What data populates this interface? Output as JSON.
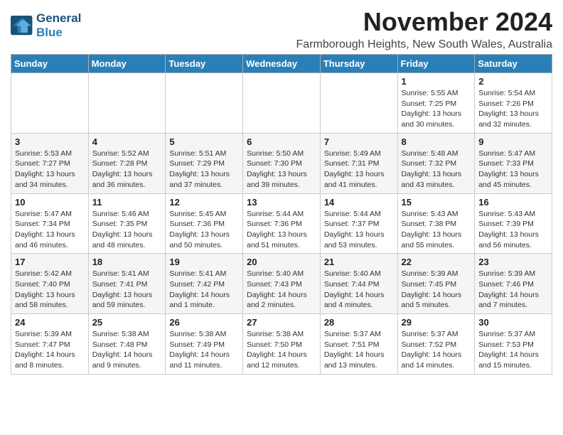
{
  "header": {
    "logo_line1": "General",
    "logo_line2": "Blue",
    "month_title": "November 2024",
    "location": "Farmborough Heights, New South Wales, Australia"
  },
  "days_of_week": [
    "Sunday",
    "Monday",
    "Tuesday",
    "Wednesday",
    "Thursday",
    "Friday",
    "Saturday"
  ],
  "weeks": [
    [
      {
        "day": "",
        "info": ""
      },
      {
        "day": "",
        "info": ""
      },
      {
        "day": "",
        "info": ""
      },
      {
        "day": "",
        "info": ""
      },
      {
        "day": "",
        "info": ""
      },
      {
        "day": "1",
        "info": "Sunrise: 5:55 AM\nSunset: 7:25 PM\nDaylight: 13 hours and 30 minutes."
      },
      {
        "day": "2",
        "info": "Sunrise: 5:54 AM\nSunset: 7:26 PM\nDaylight: 13 hours and 32 minutes."
      }
    ],
    [
      {
        "day": "3",
        "info": "Sunrise: 5:53 AM\nSunset: 7:27 PM\nDaylight: 13 hours and 34 minutes."
      },
      {
        "day": "4",
        "info": "Sunrise: 5:52 AM\nSunset: 7:28 PM\nDaylight: 13 hours and 36 minutes."
      },
      {
        "day": "5",
        "info": "Sunrise: 5:51 AM\nSunset: 7:29 PM\nDaylight: 13 hours and 37 minutes."
      },
      {
        "day": "6",
        "info": "Sunrise: 5:50 AM\nSunset: 7:30 PM\nDaylight: 13 hours and 39 minutes."
      },
      {
        "day": "7",
        "info": "Sunrise: 5:49 AM\nSunset: 7:31 PM\nDaylight: 13 hours and 41 minutes."
      },
      {
        "day": "8",
        "info": "Sunrise: 5:48 AM\nSunset: 7:32 PM\nDaylight: 13 hours and 43 minutes."
      },
      {
        "day": "9",
        "info": "Sunrise: 5:47 AM\nSunset: 7:33 PM\nDaylight: 13 hours and 45 minutes."
      }
    ],
    [
      {
        "day": "10",
        "info": "Sunrise: 5:47 AM\nSunset: 7:34 PM\nDaylight: 13 hours and 46 minutes."
      },
      {
        "day": "11",
        "info": "Sunrise: 5:46 AM\nSunset: 7:35 PM\nDaylight: 13 hours and 48 minutes."
      },
      {
        "day": "12",
        "info": "Sunrise: 5:45 AM\nSunset: 7:36 PM\nDaylight: 13 hours and 50 minutes."
      },
      {
        "day": "13",
        "info": "Sunrise: 5:44 AM\nSunset: 7:36 PM\nDaylight: 13 hours and 51 minutes."
      },
      {
        "day": "14",
        "info": "Sunrise: 5:44 AM\nSunset: 7:37 PM\nDaylight: 13 hours and 53 minutes."
      },
      {
        "day": "15",
        "info": "Sunrise: 5:43 AM\nSunset: 7:38 PM\nDaylight: 13 hours and 55 minutes."
      },
      {
        "day": "16",
        "info": "Sunrise: 5:43 AM\nSunset: 7:39 PM\nDaylight: 13 hours and 56 minutes."
      }
    ],
    [
      {
        "day": "17",
        "info": "Sunrise: 5:42 AM\nSunset: 7:40 PM\nDaylight: 13 hours and 58 minutes."
      },
      {
        "day": "18",
        "info": "Sunrise: 5:41 AM\nSunset: 7:41 PM\nDaylight: 13 hours and 59 minutes."
      },
      {
        "day": "19",
        "info": "Sunrise: 5:41 AM\nSunset: 7:42 PM\nDaylight: 14 hours and 1 minute."
      },
      {
        "day": "20",
        "info": "Sunrise: 5:40 AM\nSunset: 7:43 PM\nDaylight: 14 hours and 2 minutes."
      },
      {
        "day": "21",
        "info": "Sunrise: 5:40 AM\nSunset: 7:44 PM\nDaylight: 14 hours and 4 minutes."
      },
      {
        "day": "22",
        "info": "Sunrise: 5:39 AM\nSunset: 7:45 PM\nDaylight: 14 hours and 5 minutes."
      },
      {
        "day": "23",
        "info": "Sunrise: 5:39 AM\nSunset: 7:46 PM\nDaylight: 14 hours and 7 minutes."
      }
    ],
    [
      {
        "day": "24",
        "info": "Sunrise: 5:39 AM\nSunset: 7:47 PM\nDaylight: 14 hours and 8 minutes."
      },
      {
        "day": "25",
        "info": "Sunrise: 5:38 AM\nSunset: 7:48 PM\nDaylight: 14 hours and 9 minutes."
      },
      {
        "day": "26",
        "info": "Sunrise: 5:38 AM\nSunset: 7:49 PM\nDaylight: 14 hours and 11 minutes."
      },
      {
        "day": "27",
        "info": "Sunrise: 5:38 AM\nSunset: 7:50 PM\nDaylight: 14 hours and 12 minutes."
      },
      {
        "day": "28",
        "info": "Sunrise: 5:37 AM\nSunset: 7:51 PM\nDaylight: 14 hours and 13 minutes."
      },
      {
        "day": "29",
        "info": "Sunrise: 5:37 AM\nSunset: 7:52 PM\nDaylight: 14 hours and 14 minutes."
      },
      {
        "day": "30",
        "info": "Sunrise: 5:37 AM\nSunset: 7:53 PM\nDaylight: 14 hours and 15 minutes."
      }
    ]
  ]
}
